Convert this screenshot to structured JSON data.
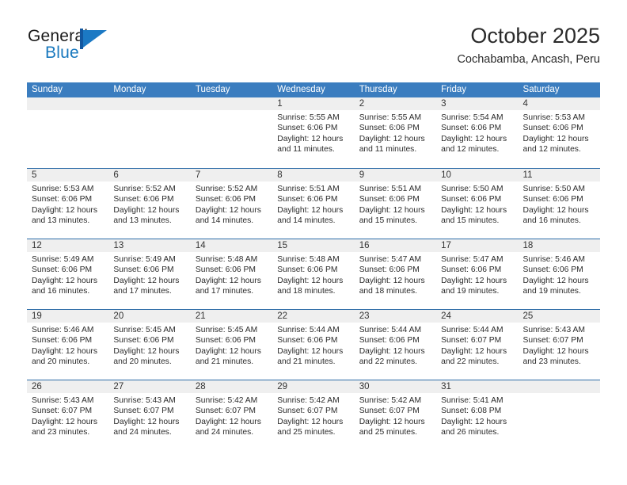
{
  "brand": {
    "name_part1": "General",
    "name_part2": "Blue",
    "mark_icon": "triangle-flag-icon"
  },
  "header": {
    "title": "October 2025",
    "subtitle": "Cochabamba, Ancash, Peru"
  },
  "colors": {
    "header_blue": "#3b7dbf",
    "separator_blue": "#2e6da8",
    "daynum_band": "#efefef",
    "brand_blue": "#1878be"
  },
  "calendar": {
    "weekday_headers": [
      "Sunday",
      "Monday",
      "Tuesday",
      "Wednesday",
      "Thursday",
      "Friday",
      "Saturday"
    ],
    "weeks": [
      [
        {
          "day": "",
          "empty": true,
          "lines": []
        },
        {
          "day": "",
          "empty": true,
          "lines": []
        },
        {
          "day": "",
          "empty": true,
          "lines": []
        },
        {
          "day": "1",
          "empty": false,
          "lines": [
            "Sunrise: 5:55 AM",
            "Sunset: 6:06 PM",
            "Daylight: 12 hours",
            "and 11 minutes."
          ]
        },
        {
          "day": "2",
          "empty": false,
          "lines": [
            "Sunrise: 5:55 AM",
            "Sunset: 6:06 PM",
            "Daylight: 12 hours",
            "and 11 minutes."
          ]
        },
        {
          "day": "3",
          "empty": false,
          "lines": [
            "Sunrise: 5:54 AM",
            "Sunset: 6:06 PM",
            "Daylight: 12 hours",
            "and 12 minutes."
          ]
        },
        {
          "day": "4",
          "empty": false,
          "lines": [
            "Sunrise: 5:53 AM",
            "Sunset: 6:06 PM",
            "Daylight: 12 hours",
            "and 12 minutes."
          ]
        }
      ],
      [
        {
          "day": "5",
          "empty": false,
          "lines": [
            "Sunrise: 5:53 AM",
            "Sunset: 6:06 PM",
            "Daylight: 12 hours",
            "and 13 minutes."
          ]
        },
        {
          "day": "6",
          "empty": false,
          "lines": [
            "Sunrise: 5:52 AM",
            "Sunset: 6:06 PM",
            "Daylight: 12 hours",
            "and 13 minutes."
          ]
        },
        {
          "day": "7",
          "empty": false,
          "lines": [
            "Sunrise: 5:52 AM",
            "Sunset: 6:06 PM",
            "Daylight: 12 hours",
            "and 14 minutes."
          ]
        },
        {
          "day": "8",
          "empty": false,
          "lines": [
            "Sunrise: 5:51 AM",
            "Sunset: 6:06 PM",
            "Daylight: 12 hours",
            "and 14 minutes."
          ]
        },
        {
          "day": "9",
          "empty": false,
          "lines": [
            "Sunrise: 5:51 AM",
            "Sunset: 6:06 PM",
            "Daylight: 12 hours",
            "and 15 minutes."
          ]
        },
        {
          "day": "10",
          "empty": false,
          "lines": [
            "Sunrise: 5:50 AM",
            "Sunset: 6:06 PM",
            "Daylight: 12 hours",
            "and 15 minutes."
          ]
        },
        {
          "day": "11",
          "empty": false,
          "lines": [
            "Sunrise: 5:50 AM",
            "Sunset: 6:06 PM",
            "Daylight: 12 hours",
            "and 16 minutes."
          ]
        }
      ],
      [
        {
          "day": "12",
          "empty": false,
          "lines": [
            "Sunrise: 5:49 AM",
            "Sunset: 6:06 PM",
            "Daylight: 12 hours",
            "and 16 minutes."
          ]
        },
        {
          "day": "13",
          "empty": false,
          "lines": [
            "Sunrise: 5:49 AM",
            "Sunset: 6:06 PM",
            "Daylight: 12 hours",
            "and 17 minutes."
          ]
        },
        {
          "day": "14",
          "empty": false,
          "lines": [
            "Sunrise: 5:48 AM",
            "Sunset: 6:06 PM",
            "Daylight: 12 hours",
            "and 17 minutes."
          ]
        },
        {
          "day": "15",
          "empty": false,
          "lines": [
            "Sunrise: 5:48 AM",
            "Sunset: 6:06 PM",
            "Daylight: 12 hours",
            "and 18 minutes."
          ]
        },
        {
          "day": "16",
          "empty": false,
          "lines": [
            "Sunrise: 5:47 AM",
            "Sunset: 6:06 PM",
            "Daylight: 12 hours",
            "and 18 minutes."
          ]
        },
        {
          "day": "17",
          "empty": false,
          "lines": [
            "Sunrise: 5:47 AM",
            "Sunset: 6:06 PM",
            "Daylight: 12 hours",
            "and 19 minutes."
          ]
        },
        {
          "day": "18",
          "empty": false,
          "lines": [
            "Sunrise: 5:46 AM",
            "Sunset: 6:06 PM",
            "Daylight: 12 hours",
            "and 19 minutes."
          ]
        }
      ],
      [
        {
          "day": "19",
          "empty": false,
          "lines": [
            "Sunrise: 5:46 AM",
            "Sunset: 6:06 PM",
            "Daylight: 12 hours",
            "and 20 minutes."
          ]
        },
        {
          "day": "20",
          "empty": false,
          "lines": [
            "Sunrise: 5:45 AM",
            "Sunset: 6:06 PM",
            "Daylight: 12 hours",
            "and 20 minutes."
          ]
        },
        {
          "day": "21",
          "empty": false,
          "lines": [
            "Sunrise: 5:45 AM",
            "Sunset: 6:06 PM",
            "Daylight: 12 hours",
            "and 21 minutes."
          ]
        },
        {
          "day": "22",
          "empty": false,
          "lines": [
            "Sunrise: 5:44 AM",
            "Sunset: 6:06 PM",
            "Daylight: 12 hours",
            "and 21 minutes."
          ]
        },
        {
          "day": "23",
          "empty": false,
          "lines": [
            "Sunrise: 5:44 AM",
            "Sunset: 6:06 PM",
            "Daylight: 12 hours",
            "and 22 minutes."
          ]
        },
        {
          "day": "24",
          "empty": false,
          "lines": [
            "Sunrise: 5:44 AM",
            "Sunset: 6:07 PM",
            "Daylight: 12 hours",
            "and 22 minutes."
          ]
        },
        {
          "day": "25",
          "empty": false,
          "lines": [
            "Sunrise: 5:43 AM",
            "Sunset: 6:07 PM",
            "Daylight: 12 hours",
            "and 23 minutes."
          ]
        }
      ],
      [
        {
          "day": "26",
          "empty": false,
          "lines": [
            "Sunrise: 5:43 AM",
            "Sunset: 6:07 PM",
            "Daylight: 12 hours",
            "and 23 minutes."
          ]
        },
        {
          "day": "27",
          "empty": false,
          "lines": [
            "Sunrise: 5:43 AM",
            "Sunset: 6:07 PM",
            "Daylight: 12 hours",
            "and 24 minutes."
          ]
        },
        {
          "day": "28",
          "empty": false,
          "lines": [
            "Sunrise: 5:42 AM",
            "Sunset: 6:07 PM",
            "Daylight: 12 hours",
            "and 24 minutes."
          ]
        },
        {
          "day": "29",
          "empty": false,
          "lines": [
            "Sunrise: 5:42 AM",
            "Sunset: 6:07 PM",
            "Daylight: 12 hours",
            "and 25 minutes."
          ]
        },
        {
          "day": "30",
          "empty": false,
          "lines": [
            "Sunrise: 5:42 AM",
            "Sunset: 6:07 PM",
            "Daylight: 12 hours",
            "and 25 minutes."
          ]
        },
        {
          "day": "31",
          "empty": false,
          "lines": [
            "Sunrise: 5:41 AM",
            "Sunset: 6:08 PM",
            "Daylight: 12 hours",
            "and 26 minutes."
          ]
        },
        {
          "day": "",
          "empty": true,
          "lines": []
        }
      ]
    ]
  }
}
